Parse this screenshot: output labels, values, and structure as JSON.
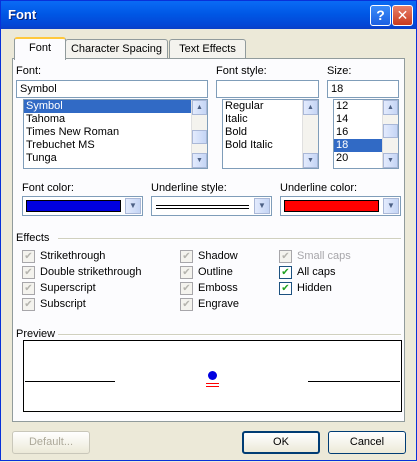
{
  "window": {
    "title": "Font",
    "help_btn": "?",
    "close_btn": "✕"
  },
  "tabs": [
    {
      "label": "Font",
      "active": true
    },
    {
      "label": "Character Spacing",
      "active": false
    },
    {
      "label": "Text Effects",
      "active": false
    }
  ],
  "font": {
    "label": "Font:",
    "value": "Symbol",
    "items": [
      "Symbol",
      "Tahoma",
      "Times New Roman",
      "Trebuchet MS",
      "Tunga"
    ],
    "selected": "Symbol"
  },
  "style": {
    "label": "Font style:",
    "value": "",
    "items": [
      "Regular",
      "Italic",
      "Bold",
      "Bold Italic"
    ]
  },
  "size": {
    "label": "Size:",
    "value": "18",
    "items": [
      "12",
      "14",
      "16",
      "18",
      "20"
    ],
    "selected": "18"
  },
  "font_color": {
    "label": "Font color:",
    "color": "#0000e0"
  },
  "underline_style": {
    "label": "Underline style:"
  },
  "underline_color": {
    "label": "Underline color:",
    "color": "#ff0000"
  },
  "effects": {
    "label": "Effects",
    "items": [
      {
        "label": "Strikethrough",
        "checked": false,
        "enabled": true
      },
      {
        "label": "Double strikethrough",
        "checked": false,
        "enabled": true
      },
      {
        "label": "Superscript",
        "checked": false,
        "enabled": true
      },
      {
        "label": "Subscript",
        "checked": false,
        "enabled": true
      },
      {
        "label": "Shadow",
        "checked": false,
        "enabled": true
      },
      {
        "label": "Outline",
        "checked": false,
        "enabled": true
      },
      {
        "label": "Emboss",
        "checked": false,
        "enabled": true
      },
      {
        "label": "Engrave",
        "checked": false,
        "enabled": true
      },
      {
        "label": "Small caps",
        "checked": false,
        "enabled": false
      },
      {
        "label": "All caps",
        "checked": true,
        "enabled": true
      },
      {
        "label": "Hidden",
        "checked": true,
        "enabled": true
      }
    ]
  },
  "preview": {
    "label": "Preview",
    "dot_color": "#0000e0",
    "underline_color": "#ff0000"
  },
  "buttons": {
    "default": "Default...",
    "ok": "OK",
    "cancel": "Cancel"
  }
}
